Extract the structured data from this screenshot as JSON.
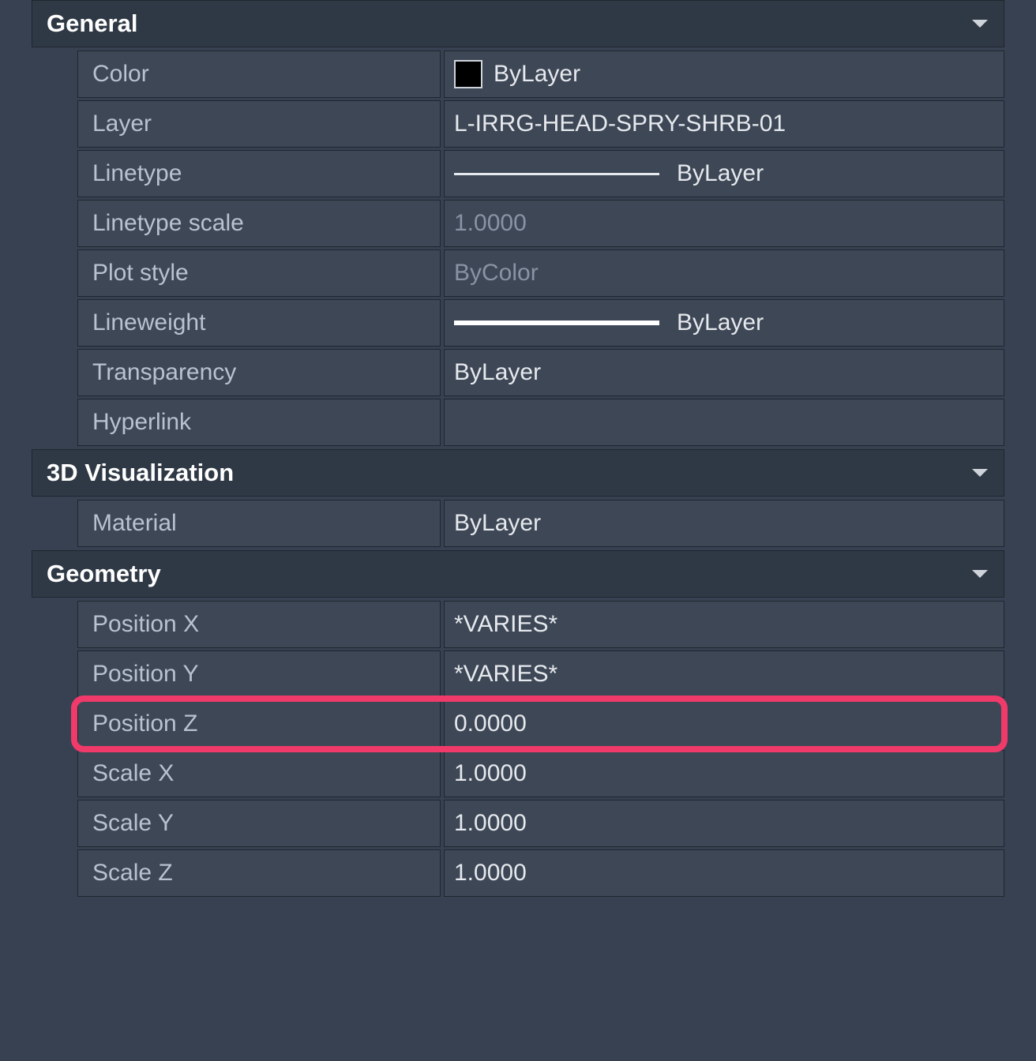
{
  "sections": {
    "general": {
      "title": "General",
      "rows": {
        "color": {
          "label": "Color",
          "value": "ByLayer"
        },
        "layer": {
          "label": "Layer",
          "value": "L-IRRG-HEAD-SPRY-SHRB-01"
        },
        "linetype": {
          "label": "Linetype",
          "value": "ByLayer"
        },
        "linetype_scale": {
          "label": "Linetype scale",
          "value": "1.0000"
        },
        "plot_style": {
          "label": "Plot style",
          "value": "ByColor"
        },
        "lineweight": {
          "label": "Lineweight",
          "value": "ByLayer"
        },
        "transparency": {
          "label": "Transparency",
          "value": "ByLayer"
        },
        "hyperlink": {
          "label": "Hyperlink",
          "value": ""
        }
      }
    },
    "visualization": {
      "title": "3D Visualization",
      "rows": {
        "material": {
          "label": "Material",
          "value": "ByLayer"
        }
      }
    },
    "geometry": {
      "title": "Geometry",
      "rows": {
        "pos_x": {
          "label": "Position X",
          "value": "*VARIES*"
        },
        "pos_y": {
          "label": "Position Y",
          "value": "*VARIES*"
        },
        "pos_z": {
          "label": "Position Z",
          "value": "0.0000"
        },
        "scale_x": {
          "label": "Scale X",
          "value": "1.0000"
        },
        "scale_y": {
          "label": "Scale Y",
          "value": "1.0000"
        },
        "scale_z": {
          "label": "Scale Z",
          "value": "1.0000"
        }
      }
    }
  }
}
